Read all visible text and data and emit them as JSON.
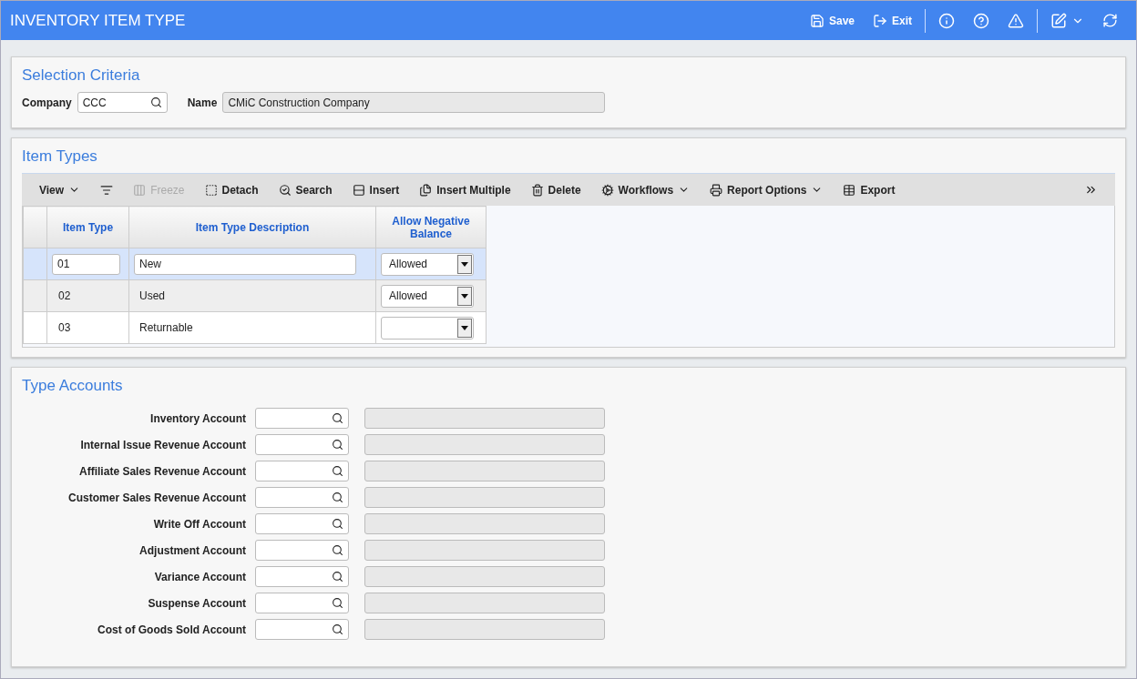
{
  "header": {
    "title": "INVENTORY ITEM TYPE",
    "actions": [
      {
        "label": "Save"
      },
      {
        "label": "Exit"
      }
    ]
  },
  "selection": {
    "title": "Selection Criteria",
    "company_label": "Company",
    "company_value": "CCC",
    "name_label": "Name",
    "name_value": "CMiC Construction Company"
  },
  "item_types": {
    "title": "Item Types",
    "toolbar": [
      {
        "label": "View",
        "caret": true,
        "disabled": false
      },
      {
        "caret": false,
        "disabled": false
      },
      {
        "label": "Freeze",
        "caret": false,
        "disabled": true
      },
      {
        "label": "Detach",
        "caret": false,
        "disabled": false
      },
      {
        "label": "Search",
        "caret": false,
        "disabled": false
      },
      {
        "label": "Insert",
        "caret": false,
        "disabled": false
      },
      {
        "label": "Insert Multiple",
        "caret": false,
        "disabled": false
      },
      {
        "label": "Delete",
        "caret": false,
        "disabled": false
      },
      {
        "label": "Workflows",
        "caret": true,
        "disabled": false
      },
      {
        "label": "Report Options",
        "caret": true,
        "disabled": false
      },
      {
        "label": "Export",
        "caret": false,
        "disabled": false
      }
    ],
    "columns": [
      "Item Type",
      "Item Type Description",
      "Allow Negative Balance"
    ],
    "rows": [
      {
        "selected": true,
        "cells": [
          "01",
          "New",
          "Allowed"
        ]
      },
      {
        "selected": false,
        "cells": [
          "02",
          "Used",
          "Allowed"
        ]
      },
      {
        "selected": false,
        "cells": [
          "03",
          "Returnable",
          ""
        ]
      }
    ]
  },
  "accounts": {
    "title": "Type Accounts",
    "fields": [
      "Inventory Account",
      "Internal Issue Revenue Account",
      "Affiliate Sales Revenue Account",
      "Customer Sales Revenue Account",
      "Write Off Account",
      "Adjustment Account",
      "Variance Account",
      "Suspense Account",
      "Cost of Goods Sold Account"
    ]
  }
}
